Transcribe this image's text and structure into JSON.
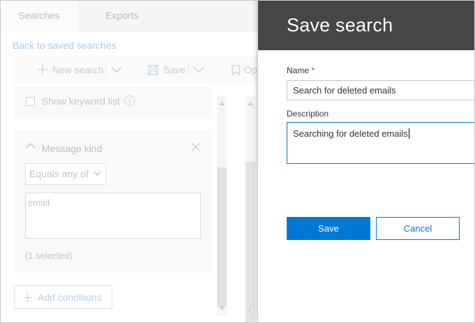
{
  "colors": {
    "accent": "#0078d4",
    "header_bg": "#464646",
    "required": "#d13438"
  },
  "background": {
    "tabs": [
      {
        "label": "Searches",
        "active": true
      },
      {
        "label": "Exports",
        "active": false
      }
    ],
    "back_link": "Back to saved searches",
    "toolbar": {
      "new_search_label": "New search",
      "save_label": "Save",
      "open_label": "Op"
    },
    "keyword_list_label": "Show keyword list",
    "condition": {
      "title": "Message kind",
      "operator": "Equals any of",
      "value": "email",
      "selected_count": "(1 selected)"
    },
    "add_conditions_label": "Add conditions"
  },
  "panel": {
    "title": "Save search",
    "name_label": "Name",
    "required_marker": "*",
    "name_value": "Search for deleted emails",
    "description_label": "Description",
    "description_value": "Searching for deleted emails",
    "save_button": "Save",
    "cancel_button": "Cancel"
  }
}
